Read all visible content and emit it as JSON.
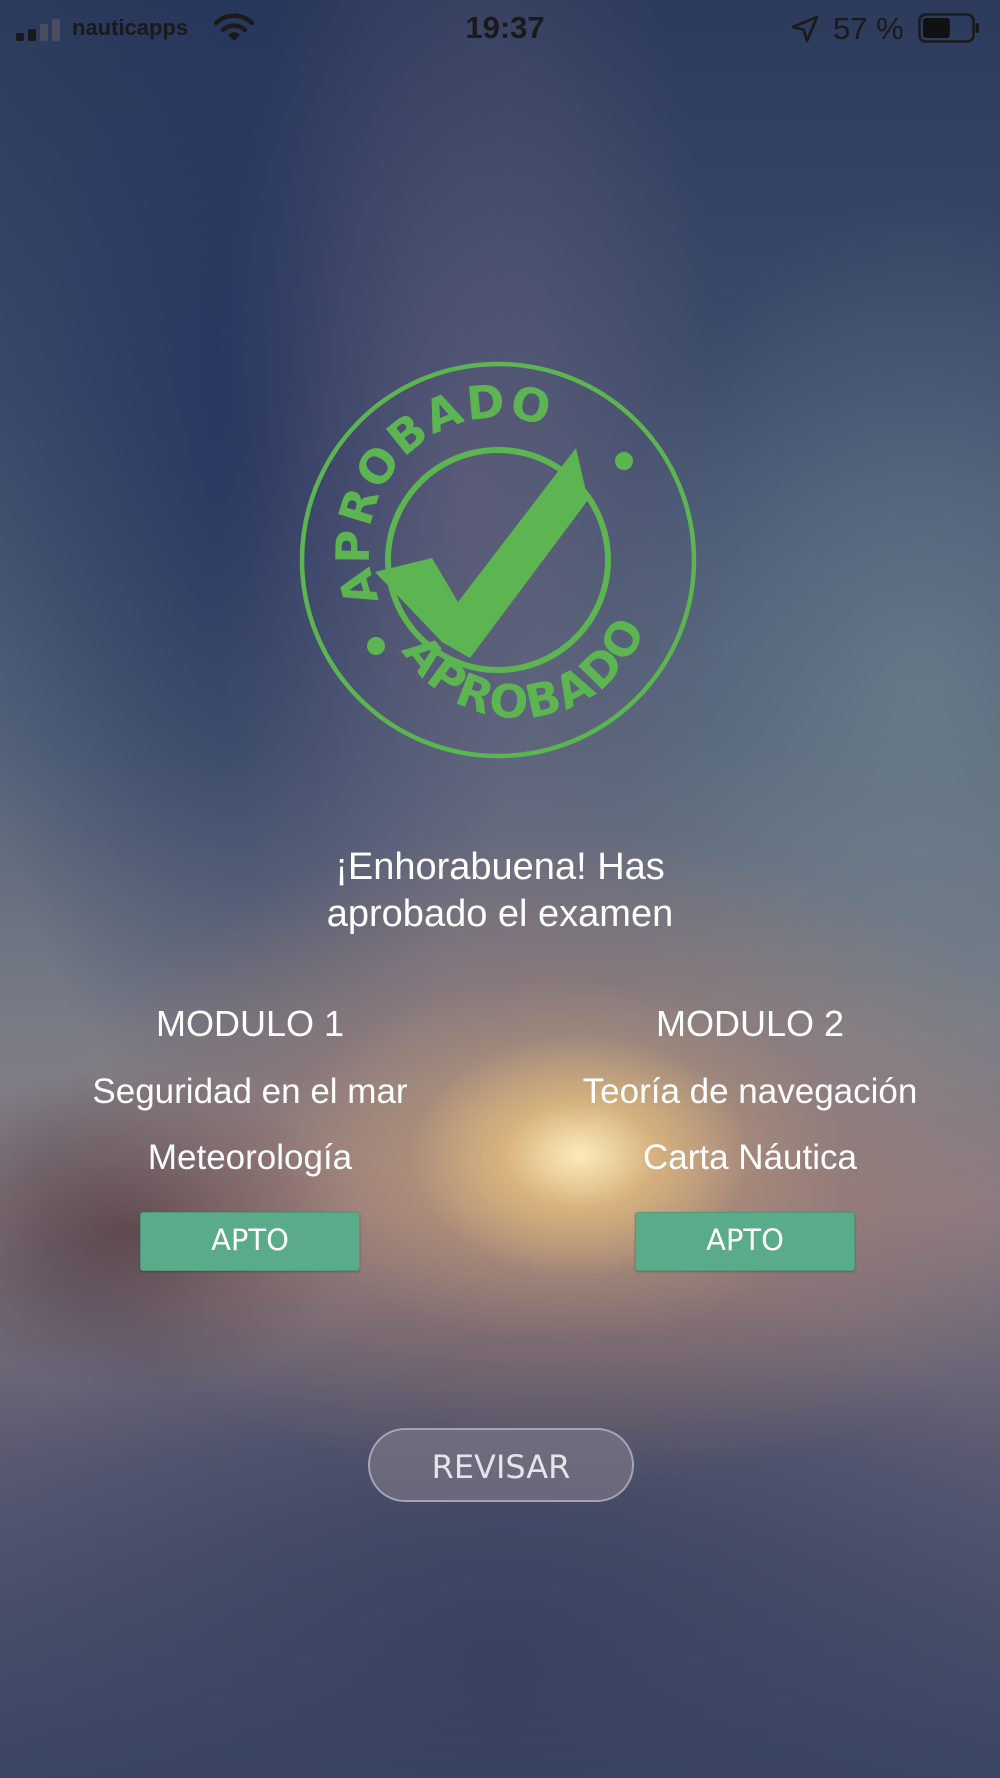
{
  "status_bar": {
    "carrier": "nauticapps",
    "time": "19:37",
    "battery_percent": "57 %",
    "battery_level": 0.57,
    "signal_bars_active": 2,
    "signal_bars_total": 4,
    "icons": [
      "signal-icon",
      "wifi-icon",
      "location-arrow-icon",
      "battery-icon"
    ]
  },
  "stamp": {
    "text": "APROBADO",
    "icon": "checkmark-icon",
    "color": "#5db552"
  },
  "headline": {
    "line1": "¡Enhorabuena! Has",
    "line2": "aprobado el examen"
  },
  "modules": [
    {
      "title": "MODULO 1",
      "subjects": [
        "Seguridad en el mar",
        "Meteorología"
      ],
      "result": "APTO"
    },
    {
      "title": "MODULO 2",
      "subjects": [
        "Teoría de navegación",
        "Carta Náutica"
      ],
      "result": "APTO"
    }
  ],
  "actions": {
    "review_label": "REVISAR"
  },
  "colors": {
    "badge": "#5aab8a",
    "stamp_green": "#5db552",
    "text": "#ffffff"
  }
}
